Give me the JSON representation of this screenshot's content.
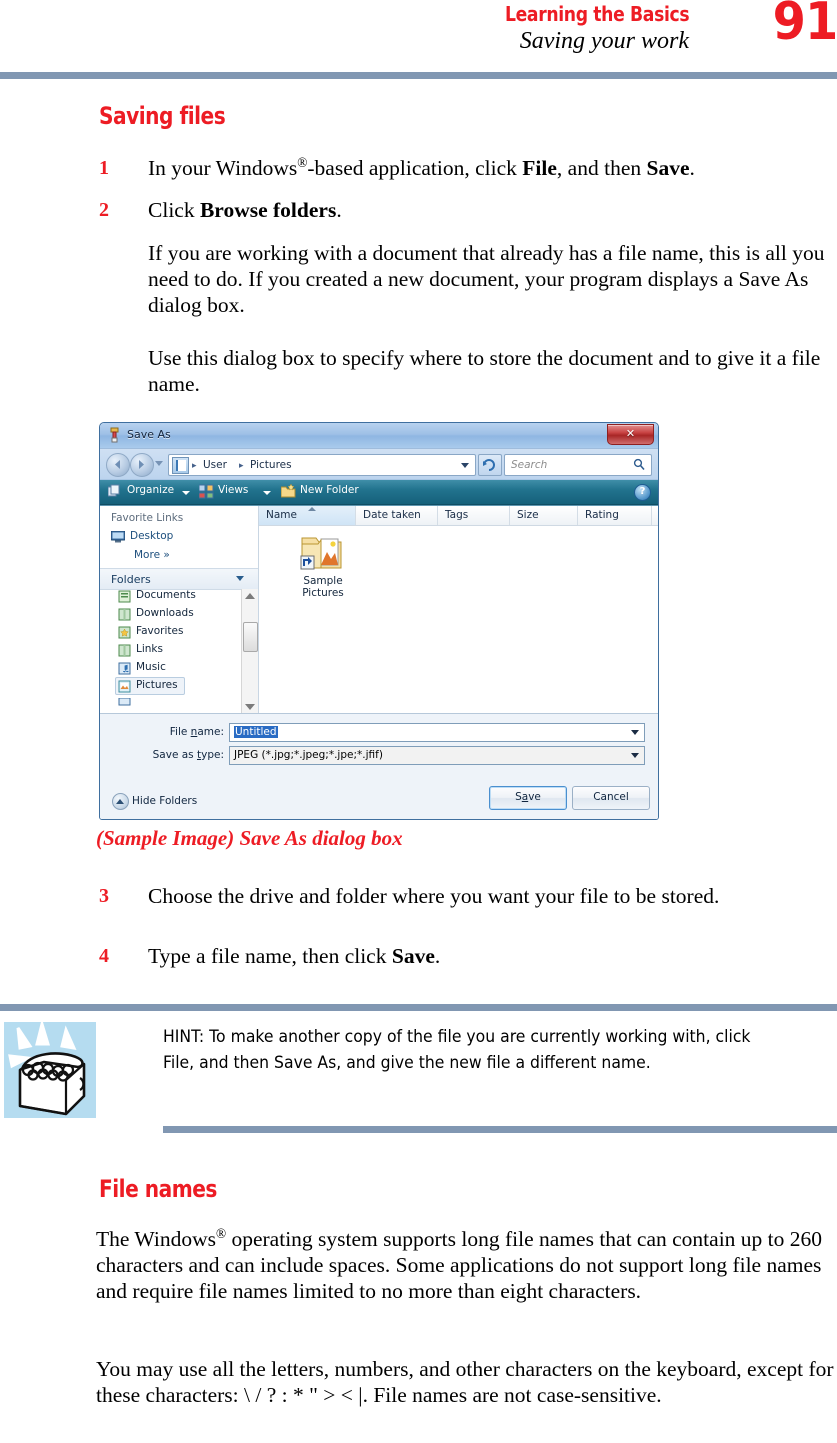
{
  "header": {
    "chapter": "Learning the Basics",
    "section": "Saving your work",
    "page_number": "91"
  },
  "section1": {
    "heading": "Saving files",
    "steps": [
      {
        "num": "1",
        "html": "In your Windows<sup>&#174;</sup>-based application, click <b>File</b>, and then <b>Save</b>."
      },
      {
        "num": "2",
        "html": "Click <b>Browse folders</b>."
      }
    ],
    "paragraphs": [
      "If you are working with a document that already has a file name, this is all you need to do. If you created a new document, your program displays a Save As dialog box.",
      "Use this dialog box to specify where to store the document and to give it a file name."
    ],
    "steps2": [
      {
        "num": "3",
        "html": "Choose the drive and folder where you want your file to be stored."
      },
      {
        "num": "4",
        "html": "Type a file name, then click <b>Save</b>."
      }
    ]
  },
  "figure": {
    "caption": "(Sample Image) Save As dialog box",
    "dialog": {
      "title": "Save As",
      "close_label": "✕",
      "address": {
        "crumbs": [
          "User",
          "Pictures"
        ],
        "separator": "▸"
      },
      "search_placeholder": "Search",
      "toolbar": {
        "organize": "Organize",
        "views": "Views",
        "new_folder": "New Folder",
        "help": "?"
      },
      "left_pane": {
        "favorite_links_title": "Favorite Links",
        "favorites": [
          "Desktop",
          "More  »"
        ],
        "folders_label": "Folders",
        "tree": [
          "Documents",
          "Downloads",
          "Favorites",
          "Links",
          "Music",
          "Pictures"
        ],
        "tree_selected": "Pictures"
      },
      "columns": [
        "Name",
        "Date taken",
        "Tags",
        "Size",
        "Rating"
      ],
      "files": [
        {
          "name_line1": "Sample",
          "name_line2": "Pictures"
        }
      ],
      "form": {
        "file_name_label_pre": "File ",
        "file_name_label_key": "n",
        "file_name_label_post": "ame:",
        "file_name_value": "Untitled",
        "save_as_type_label_pre": "Save as ",
        "save_as_type_label_key": "t",
        "save_as_type_label_post": "ype:",
        "save_as_type_value": "JPEG (*.jpg;*.jpeg;*.jpe;*.jfif)",
        "hide_folders": "Hide Folders",
        "save_label_pre": "S",
        "save_label_key": "a",
        "save_label_post": "ve",
        "cancel_label": "Cancel"
      }
    }
  },
  "hint": {
    "label": "HINT:",
    "html": "HINT: To make another copy of the file you are currently working with, click File, and then Save As, and give the new file a different name."
  },
  "section2": {
    "heading": "File names",
    "paragraphs": [
      "The Windows<sup>&#174;</sup> operating system supports long file names that can contain up to 260 characters and can include spaces. Some applications do not support long file names and require file names limited to no more than eight characters.",
      "You may use all the letters, numbers, and other characters on the keyboard, except for these characters: \\ / ? : * \" &gt; &lt;  |. File names are not case-sensitive."
    ]
  },
  "colors": {
    "accent_red": "#ed1c24",
    "rule_blue": "#8197b2",
    "hint_bg": "#b5dcf0",
    "selection_blue": "#2a6cc4"
  }
}
